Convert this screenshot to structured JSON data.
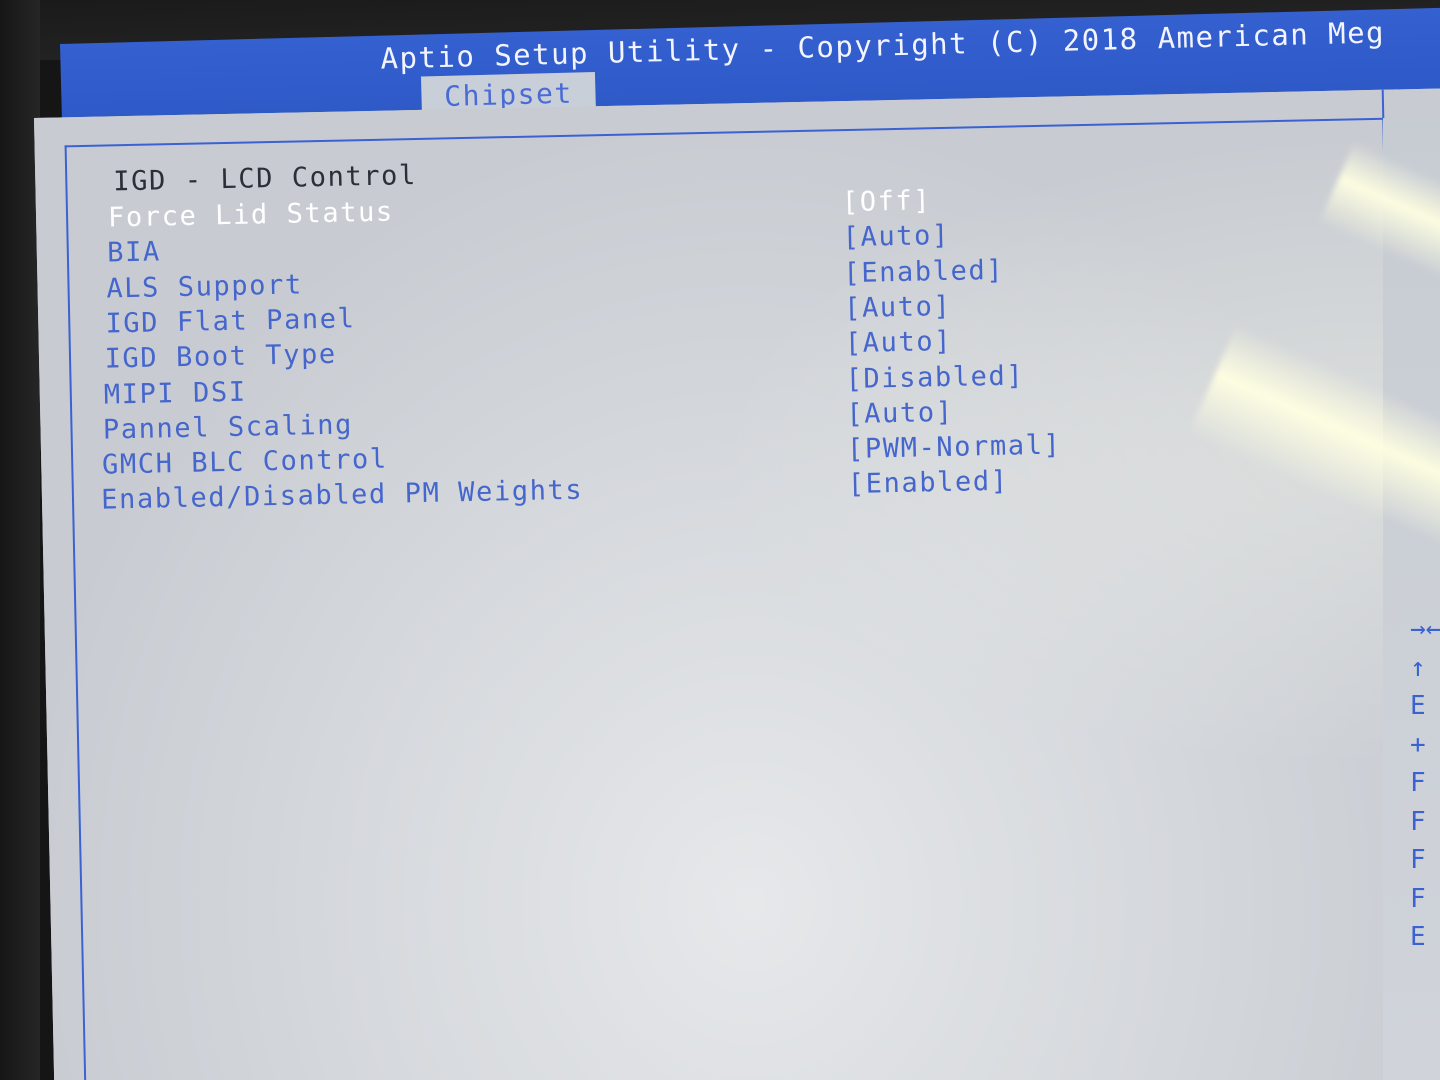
{
  "header": {
    "title": "Aptio Setup Utility - Copyright (C) 2018 American Meg",
    "active_tab": "Chipset"
  },
  "section": {
    "title": "IGD - LCD Control"
  },
  "settings": [
    {
      "label": "Force Lid Status",
      "value": "[Off]",
      "selected": true
    },
    {
      "label": "BIA",
      "value": "[Auto]",
      "selected": false
    },
    {
      "label": "ALS Support",
      "value": "[Enabled]",
      "selected": false
    },
    {
      "label": "IGD Flat Panel",
      "value": "[Auto]",
      "selected": false
    },
    {
      "label": "IGD Boot Type",
      "value": "[Auto]",
      "selected": false
    },
    {
      "label": "MIPI DSI",
      "value": "[Disabled]",
      "selected": false
    },
    {
      "label": "Pannel Scaling",
      "value": "[Auto]",
      "selected": false
    },
    {
      "label": "GMCH BLC Control",
      "value": "[PWM-Normal]",
      "selected": false
    },
    {
      "label": "Enabled/Disabled PM Weights",
      "value": "[Enabled]",
      "selected": false
    }
  ],
  "help": {
    "glyphs": [
      "→←",
      "↑",
      "E",
      "+",
      "F",
      "F",
      "F",
      "F",
      "E"
    ]
  },
  "colors": {
    "header_blue": "#2d58c6",
    "panel_grey": "#c5cad1",
    "item_blue": "#4566cc",
    "selected_white": "#ffffff",
    "title_dark": "#2b2f38"
  }
}
